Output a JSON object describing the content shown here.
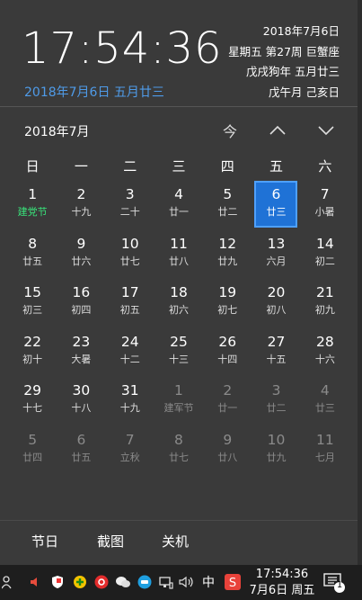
{
  "header": {
    "time": "17:54:36",
    "lunar_date_line": "2018年7月6日 五月廿三",
    "info_lines": [
      "2018年7月6日",
      "星期五 第27周 巨蟹座",
      "戊戌狗年 五月廿三",
      "戊午月 己亥日"
    ]
  },
  "calendar": {
    "month_label": "2018年7月",
    "today_button": "今",
    "weekdays": [
      "日",
      "一",
      "二",
      "三",
      "四",
      "五",
      "六"
    ],
    "weeks": [
      [
        {
          "d": "1",
          "s": "建党节",
          "t": "fest"
        },
        {
          "d": "2",
          "s": "十九"
        },
        {
          "d": "3",
          "s": "二十"
        },
        {
          "d": "4",
          "s": "廿一"
        },
        {
          "d": "5",
          "s": "廿二"
        },
        {
          "d": "6",
          "s": "廿三",
          "t": "today"
        },
        {
          "d": "7",
          "s": "小暑"
        }
      ],
      [
        {
          "d": "8",
          "s": "廿五"
        },
        {
          "d": "9",
          "s": "廿六"
        },
        {
          "d": "10",
          "s": "廿七"
        },
        {
          "d": "11",
          "s": "廿八"
        },
        {
          "d": "12",
          "s": "廿九"
        },
        {
          "d": "13",
          "s": "六月"
        },
        {
          "d": "14",
          "s": "初二"
        }
      ],
      [
        {
          "d": "15",
          "s": "初三"
        },
        {
          "d": "16",
          "s": "初四"
        },
        {
          "d": "17",
          "s": "初五"
        },
        {
          "d": "18",
          "s": "初六"
        },
        {
          "d": "19",
          "s": "初七"
        },
        {
          "d": "20",
          "s": "初八"
        },
        {
          "d": "21",
          "s": "初九"
        }
      ],
      [
        {
          "d": "22",
          "s": "初十"
        },
        {
          "d": "23",
          "s": "大暑"
        },
        {
          "d": "24",
          "s": "十二"
        },
        {
          "d": "25",
          "s": "十三"
        },
        {
          "d": "26",
          "s": "十四"
        },
        {
          "d": "27",
          "s": "十五"
        },
        {
          "d": "28",
          "s": "十六"
        }
      ],
      [
        {
          "d": "29",
          "s": "十七"
        },
        {
          "d": "30",
          "s": "十八"
        },
        {
          "d": "31",
          "s": "十九"
        },
        {
          "d": "1",
          "s": "建军节",
          "t": "other"
        },
        {
          "d": "2",
          "s": "廿一",
          "t": "other"
        },
        {
          "d": "3",
          "s": "廿二",
          "t": "other"
        },
        {
          "d": "4",
          "s": "廿三",
          "t": "other"
        }
      ],
      [
        {
          "d": "5",
          "s": "廿四",
          "t": "other"
        },
        {
          "d": "6",
          "s": "廿五",
          "t": "other"
        },
        {
          "d": "7",
          "s": "立秋",
          "t": "other"
        },
        {
          "d": "8",
          "s": "廿七",
          "t": "other"
        },
        {
          "d": "9",
          "s": "廿八",
          "t": "other"
        },
        {
          "d": "10",
          "s": "廿九",
          "t": "other"
        },
        {
          "d": "11",
          "s": "七月",
          "t": "other"
        }
      ]
    ]
  },
  "footer": {
    "festival": "节日",
    "screenshot": "截图",
    "shutdown": "关机"
  },
  "taskbar": {
    "ime": "中",
    "time": "17:54:36",
    "date": "7月6日 周五",
    "notification_count": "1"
  },
  "colors": {
    "accent": "#4f9be8",
    "today_bg": "#1f72d6",
    "festival": "#39e27a",
    "panel": "#3a3a3a"
  }
}
